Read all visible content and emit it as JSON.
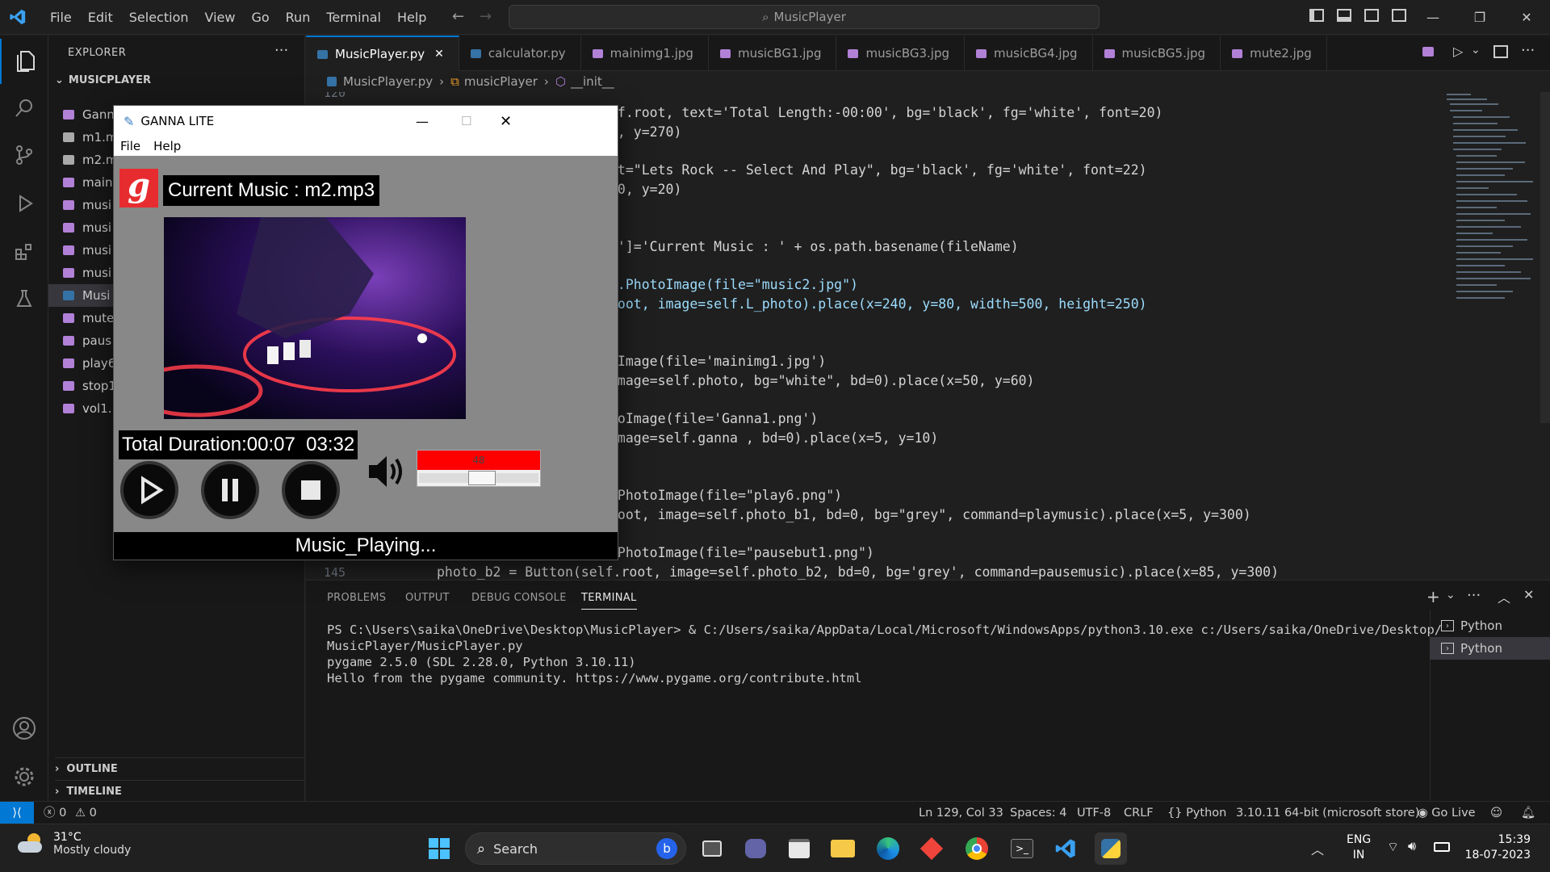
{
  "titlebar": {
    "menu": [
      "File",
      "Edit",
      "Selection",
      "View",
      "Go",
      "Run",
      "Terminal",
      "Help"
    ],
    "search": "MusicPlayer"
  },
  "sidebar": {
    "title": "EXPLORER",
    "folder": "MUSICPLAYER",
    "files": [
      "Ganna1.png",
      "m1.m",
      "m2.m",
      "main",
      "musi",
      "musi",
      "musi",
      "musi",
      "Musi",
      "mute",
      "paus",
      "play6",
      "stop1",
      "vol1."
    ],
    "outline": "OUTLINE",
    "timeline": "TIMELINE"
  },
  "tabs": [
    {
      "label": "MusicPlayer.py",
      "type": "py",
      "active": true
    },
    {
      "label": "calculator.py",
      "type": "py",
      "active": false
    },
    {
      "label": "mainimg1.jpg",
      "type": "img",
      "active": false
    },
    {
      "label": "musicBG1.jpg",
      "type": "img",
      "active": false
    },
    {
      "label": "musicBG3.jpg",
      "type": "img",
      "active": false
    },
    {
      "label": "musicBG4.jpg",
      "type": "img",
      "active": false
    },
    {
      "label": "musicBG5.jpg",
      "type": "img",
      "active": false
    },
    {
      "label": "mute2.jpg",
      "type": "img",
      "active": false
    }
  ],
  "breadcrumb": [
    "MusicPlayer.py",
    "musicPlayer",
    "__init__"
  ],
  "editor": {
    "line_top": "120",
    "line_bottom": "145",
    "lines": [
      "lf.root, text='Total Length:-00:00', bg='black', fg='white', font=20)",
      "5, y=270)",
      "",
      "xt=\"Lets Rock -- Select And Play\", bg='black', fg='white', font=22)",
      "50, y=20)",
      "",
      "",
      "t']='Current Music : ' + os.path.basename(fileName)",
      "e",
      "k.PhotoImage(file=\"music2.jpg\")",
      "root, image=self.L_photo).place(x=240, y=80, width=500, height=250)",
      "",
      "",
      "oImage(file='mainimg1.jpg')",
      "image=self.photo, bg=\"white\", bd=0).place(x=50, y=60)",
      "",
      "toImage(file='Ganna1.png')",
      "image=self.ganna , bd=0).place(x=5, y=10)",
      "",
      "",
      ".PhotoImage(file=\"play6.png\")",
      "root, image=self.photo_b1, bd=0, bg=\"grey\", command=playmusic).place(x=5, y=300)",
      "",
      ".PhotoImage(file=\"pausebut1.png\")",
      "photo_b2 = Button(self.root, image=self.photo_b2, bd=0, bg='grey', command=pausemusic).place(x=85, y=300)"
    ]
  },
  "panel": {
    "tabs": [
      "PROBLEMS",
      "OUTPUT",
      "DEBUG CONSOLE",
      "TERMINAL"
    ],
    "terminal_lines": [
      "PS C:\\Users\\saika\\OneDrive\\Desktop\\MusicPlayer> & C:/Users/saika/AppData/Local/Microsoft/WindowsApps/python3.10.exe c:/Users/saika/OneDrive/Desktop/",
      "MusicPlayer/MusicPlayer.py",
      "pygame 2.5.0 (SDL 2.28.0, Python 3.10.11)",
      "Hello from the pygame community. https://www.pygame.org/contribute.html"
    ],
    "terminals": [
      "Python",
      "Python"
    ]
  },
  "status": {
    "errors": "0",
    "warnings": "0",
    "position": "Ln 129, Col 33",
    "spaces": "Spaces: 4",
    "encoding": "UTF-8",
    "eol": "CRLF",
    "language": "Python",
    "interpreter": "3.10.11 64-bit (microsoft store)",
    "golive": "Go Live"
  },
  "ganna": {
    "title": "GANNA LITE",
    "menu": [
      "File",
      "Help"
    ],
    "current": "Current Music : m2.mp3",
    "duration": "Total Duration:00:07  03:32",
    "volume": "48",
    "volume_fraction": 0.48,
    "status": "Music_Playing..."
  },
  "taskbar": {
    "temp": "31°C",
    "weather": "Mostly cloudy",
    "search": "Search",
    "lang1": "ENG",
    "lang2": "IN",
    "time": "15:39",
    "date": "18-07-2023"
  }
}
